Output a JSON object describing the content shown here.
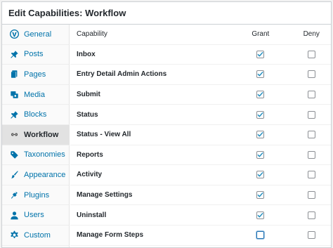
{
  "panel": {
    "title": "Edit Capabilities: Workflow"
  },
  "sidebar": {
    "items": [
      {
        "label": "General",
        "icon": "wordpress-icon",
        "active": false
      },
      {
        "label": "Posts",
        "icon": "pin-icon",
        "active": false
      },
      {
        "label": "Pages",
        "icon": "pages-icon",
        "active": false
      },
      {
        "label": "Media",
        "icon": "media-icon",
        "active": false
      },
      {
        "label": "Blocks",
        "icon": "pin-icon",
        "active": false
      },
      {
        "label": "Workflow",
        "icon": "link-icon",
        "active": true
      },
      {
        "label": "Taxonomies",
        "icon": "tag-icon",
        "active": false
      },
      {
        "label": "Appearance",
        "icon": "brush-icon",
        "active": false
      },
      {
        "label": "Plugins",
        "icon": "plugin-icon",
        "active": false
      },
      {
        "label": "Users",
        "icon": "user-icon",
        "active": false
      },
      {
        "label": "Custom",
        "icon": "gear-icon",
        "active": false
      }
    ]
  },
  "table": {
    "headers": {
      "capability": "Capability",
      "grant": "Grant",
      "deny": "Deny"
    },
    "rows": [
      {
        "capability": "Inbox",
        "grant": true,
        "deny": false
      },
      {
        "capability": "Entry Detail Admin Actions",
        "grant": true,
        "deny": false
      },
      {
        "capability": "Submit",
        "grant": true,
        "deny": false
      },
      {
        "capability": "Status",
        "grant": true,
        "deny": false
      },
      {
        "capability": "Status - View All",
        "grant": true,
        "deny": false
      },
      {
        "capability": "Reports",
        "grant": true,
        "deny": false
      },
      {
        "capability": "Activity",
        "grant": true,
        "deny": false
      },
      {
        "capability": "Manage Settings",
        "grant": true,
        "deny": false
      },
      {
        "capability": "Uninstall",
        "grant": true,
        "deny": false
      },
      {
        "capability": "Manage Form Steps",
        "grant": false,
        "deny": false
      }
    ]
  },
  "colors": {
    "link": "#0073aa",
    "check": "#1e8cbe",
    "active_bg": "#e2e2e2"
  }
}
